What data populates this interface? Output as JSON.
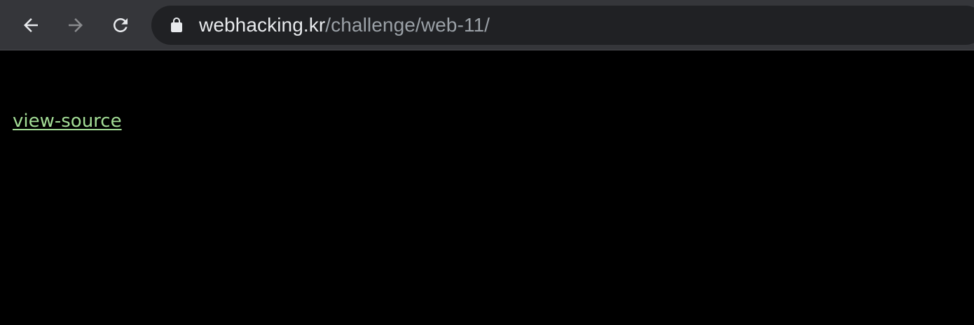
{
  "browser": {
    "nav": {
      "back_icon": "arrow-left-icon",
      "forward_icon": "arrow-right-icon",
      "reload_icon": "reload-icon"
    },
    "omnibox": {
      "lock_icon": "lock-icon",
      "host": "webhacking.kr",
      "path": "/challenge/web-11/"
    }
  },
  "page": {
    "link_label": "view-source",
    "link_color": "#a3dd96",
    "background": "#000000"
  }
}
